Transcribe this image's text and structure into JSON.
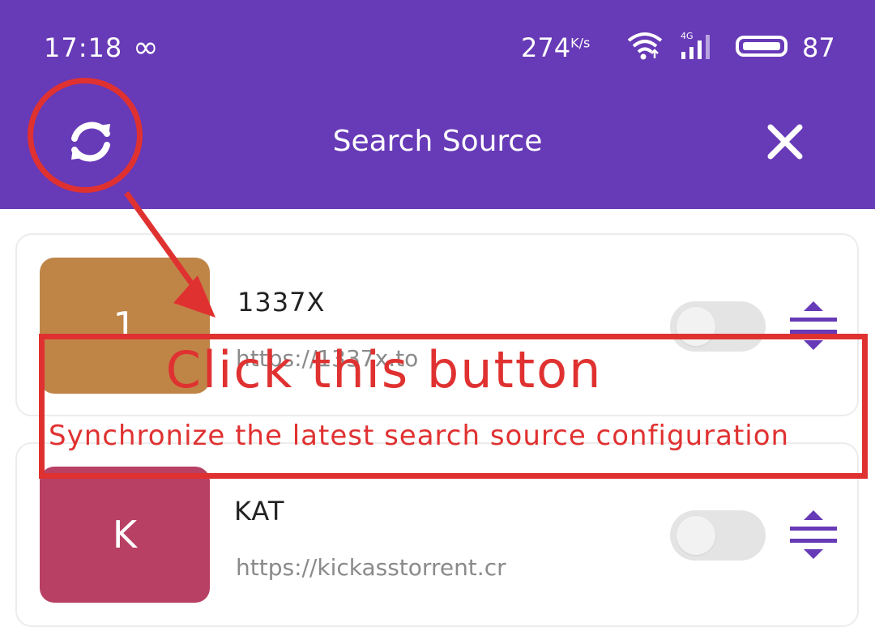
{
  "status_bar": {
    "time": "17:18",
    "speed": "274",
    "speed_unit": "K/s",
    "network": "4G",
    "battery": "87"
  },
  "header": {
    "title": "Search Source",
    "refresh_icon": "refresh-icon",
    "close_icon": "close-icon",
    "background": "#673ab7"
  },
  "sources": [
    {
      "avatar_letter": "1",
      "name": "1337X",
      "url": "https://1337x.to",
      "enabled": false,
      "color": "#bf8547"
    },
    {
      "avatar_letter": "K",
      "name": "KAT",
      "url": "https://kickasstorrent.cr",
      "enabled": false,
      "color": "#b84065"
    }
  ],
  "annotation": {
    "title": "Click this button",
    "subtitle": "Synchronize the latest search source configuration",
    "color": "#e03131"
  }
}
